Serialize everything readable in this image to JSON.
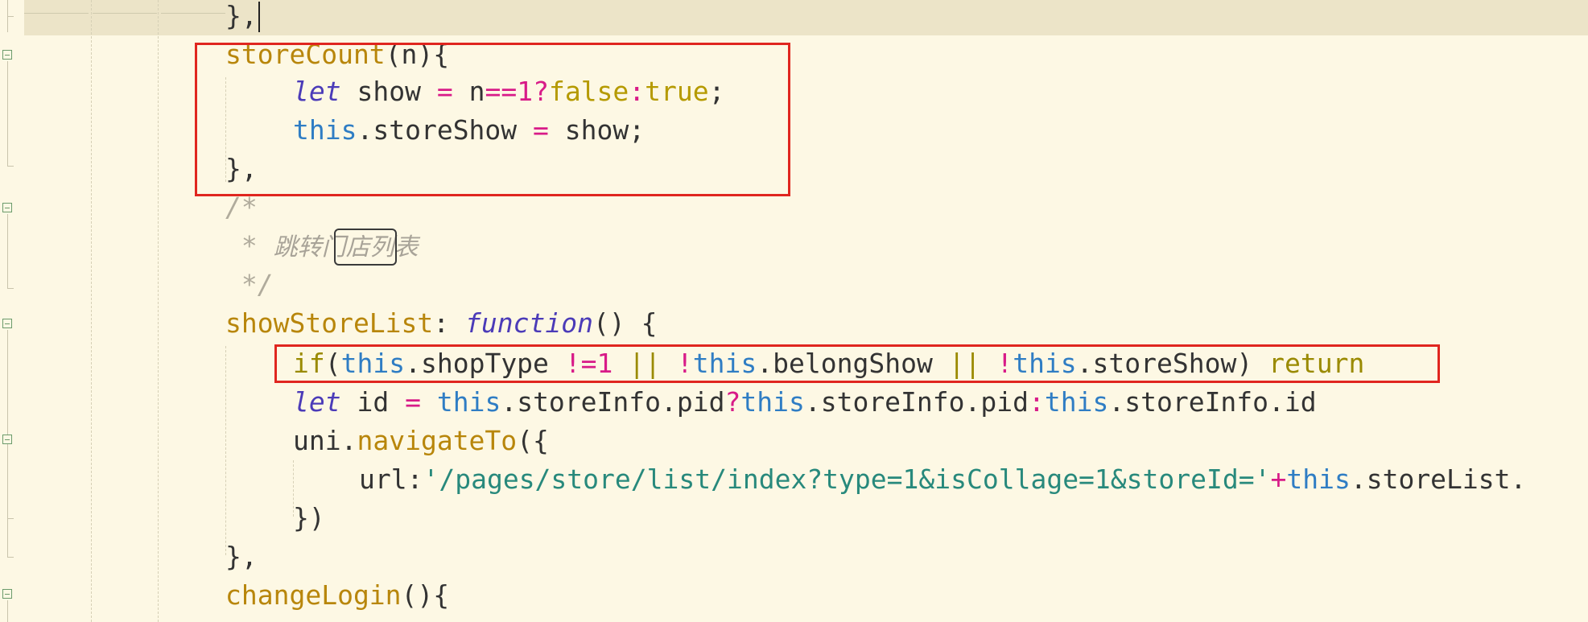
{
  "editor": {
    "lines": [
      {
        "id": "l0",
        "segments": [
          {
            "t": "},",
            "c": "plain"
          }
        ]
      },
      {
        "id": "l1",
        "segments": [
          {
            "t": "storeCount",
            "c": "fn"
          },
          {
            "t": "(n){",
            "c": "plain"
          }
        ]
      },
      {
        "id": "l2",
        "segments": [
          {
            "t": "let",
            "c": "kw-italic"
          },
          {
            "t": " show ",
            "c": "plain"
          },
          {
            "t": "=",
            "c": "kw-op"
          },
          {
            "t": " n",
            "c": "plain"
          },
          {
            "t": "==",
            "c": "kw-op"
          },
          {
            "t": "1",
            "c": "kw-op"
          },
          {
            "t": "?",
            "c": "kw-op"
          },
          {
            "t": "false",
            "c": "kw-bool"
          },
          {
            "t": ":",
            "c": "kw-op"
          },
          {
            "t": "true",
            "c": "kw-bool"
          },
          {
            "t": ";",
            "c": "plain"
          }
        ]
      },
      {
        "id": "l3",
        "segments": [
          {
            "t": "this",
            "c": "kw-this"
          },
          {
            "t": ".storeShow ",
            "c": "plain"
          },
          {
            "t": "=",
            "c": "kw-op"
          },
          {
            "t": " show;",
            "c": "plain"
          }
        ]
      },
      {
        "id": "l4",
        "segments": [
          {
            "t": "},",
            "c": "plain"
          }
        ]
      },
      {
        "id": "l5",
        "segments": [
          {
            "t": "/*",
            "c": "cmt"
          }
        ]
      },
      {
        "id": "l6",
        "segments": [
          {
            "t": " * ",
            "c": "cmt"
          },
          {
            "t": "跳转门店列表",
            "c": "cmt-cn"
          }
        ]
      },
      {
        "id": "l7",
        "segments": [
          {
            "t": " */",
            "c": "cmt"
          }
        ]
      },
      {
        "id": "l8",
        "segments": [
          {
            "t": "showStoreList",
            "c": "fn"
          },
          {
            "t": ": ",
            "c": "plain"
          },
          {
            "t": "function",
            "c": "kw-italic"
          },
          {
            "t": "() {",
            "c": "plain"
          }
        ]
      },
      {
        "id": "l9",
        "segments": [
          {
            "t": "if",
            "c": "kw-ctl"
          },
          {
            "t": "(",
            "c": "plain"
          },
          {
            "t": "this",
            "c": "kw-this"
          },
          {
            "t": ".shopType ",
            "c": "plain"
          },
          {
            "t": "!=",
            "c": "kw-op"
          },
          {
            "t": "1",
            "c": "kw-op"
          },
          {
            "t": " ",
            "c": "plain"
          },
          {
            "t": "||",
            "c": "kw-ctl"
          },
          {
            "t": " ",
            "c": "plain"
          },
          {
            "t": "!",
            "c": "kw-op"
          },
          {
            "t": "this",
            "c": "kw-this"
          },
          {
            "t": ".belongShow ",
            "c": "plain"
          },
          {
            "t": "||",
            "c": "kw-ctl"
          },
          {
            "t": " ",
            "c": "plain"
          },
          {
            "t": "!",
            "c": "kw-op"
          },
          {
            "t": "this",
            "c": "kw-this"
          },
          {
            "t": ".storeShow) ",
            "c": "plain"
          },
          {
            "t": "return",
            "c": "kw-ctl"
          }
        ]
      },
      {
        "id": "l10",
        "segments": [
          {
            "t": "let",
            "c": "kw-italic"
          },
          {
            "t": " id ",
            "c": "plain"
          },
          {
            "t": "=",
            "c": "kw-op"
          },
          {
            "t": " ",
            "c": "plain"
          },
          {
            "t": "this",
            "c": "kw-this"
          },
          {
            "t": ".storeInfo.pid",
            "c": "plain"
          },
          {
            "t": "?",
            "c": "kw-op"
          },
          {
            "t": "this",
            "c": "kw-this"
          },
          {
            "t": ".storeInfo.pid",
            "c": "plain"
          },
          {
            "t": ":",
            "c": "kw-op"
          },
          {
            "t": "this",
            "c": "kw-this"
          },
          {
            "t": ".storeInfo.id",
            "c": "plain"
          }
        ]
      },
      {
        "id": "l11",
        "segments": [
          {
            "t": "uni.",
            "c": "plain"
          },
          {
            "t": "navigateTo",
            "c": "fn"
          },
          {
            "t": "({",
            "c": "plain"
          }
        ]
      },
      {
        "id": "l12",
        "segments": [
          {
            "t": "url:",
            "c": "plain"
          },
          {
            "t": "'/pages/store/list/index?type=1&isCollage=1&storeId='",
            "c": "str"
          },
          {
            "t": "+",
            "c": "kw-op"
          },
          {
            "t": "this",
            "c": "kw-this"
          },
          {
            "t": ".storeList.",
            "c": "plain"
          }
        ]
      },
      {
        "id": "l13",
        "segments": [
          {
            "t": "})",
            "c": "plain"
          }
        ]
      },
      {
        "id": "l14",
        "segments": [
          {
            "t": "},",
            "c": "plain"
          }
        ]
      },
      {
        "id": "l15",
        "segments": [
          {
            "t": "changeLogin",
            "c": "fn"
          },
          {
            "t": "(){",
            "c": "plain"
          }
        ]
      }
    ]
  }
}
